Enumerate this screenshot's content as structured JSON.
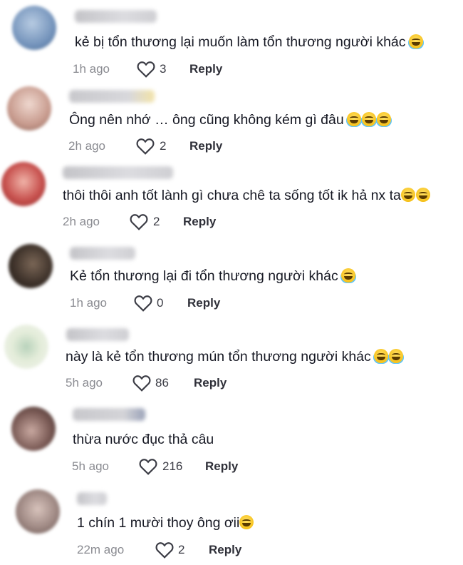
{
  "comments": [
    {
      "text": "kẻ bị tổn thương lại muốn làm tổn thương người khác",
      "emojis": [
        "tear"
      ],
      "time": "1h ago",
      "likes": "3",
      "reply": "Reply",
      "avatar_color": "#8aa6c8"
    },
    {
      "text": "Ông nên nhớ … ông cũng không kém gì đâu",
      "emojis": [
        "tear",
        "tear",
        "tear"
      ],
      "time": "2h ago",
      "likes": "2",
      "reply": "Reply",
      "avatar_color": "#c79a8d"
    },
    {
      "text": "thôi thôi anh tốt lành gì chưa chê ta sống tốt ik hả nx ta",
      "emojis": [
        "smile",
        "smile"
      ],
      "time": "2h ago",
      "likes": "2",
      "reply": "Reply",
      "avatar_color": "#c8524f"
    },
    {
      "text": "Kẻ tổn thương lại đi tổn thương người khác",
      "emojis": [
        "tear"
      ],
      "time": "1h ago",
      "likes": "0",
      "reply": "Reply",
      "avatar_color": "#4a3c34"
    },
    {
      "text": "này là kẻ tổn thương mún tổn thương người khác",
      "emojis": [
        "tear",
        "tear"
      ],
      "time": "5h ago",
      "likes": "86",
      "reply": "Reply",
      "avatar_color": "#e3ecd9"
    },
    {
      "text": "thừa nước đục thả câu",
      "emojis": [],
      "time": "5h ago",
      "likes": "216",
      "reply": "Reply",
      "avatar_color": "#7a5a55"
    },
    {
      "text": "1 chín 1 mười thoy ông ơii",
      "emojis": [
        "smirk"
      ],
      "time": "22m ago",
      "likes": "2",
      "reply": "Reply",
      "avatar_color": "#9b8580"
    }
  ]
}
